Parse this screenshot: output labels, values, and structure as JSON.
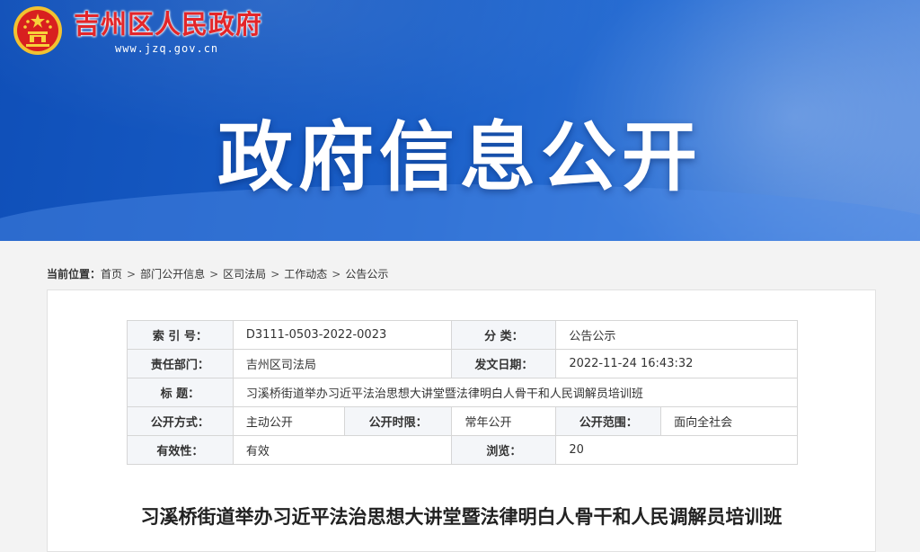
{
  "header": {
    "site_name": "吉州区人民政府",
    "site_url": "www.jzq.gov.cn",
    "banner_title": "政府信息公开"
  },
  "breadcrumb": {
    "label": "当前位置：",
    "items": [
      "首页",
      "部门公开信息",
      "区司法局",
      "工作动态",
      "公告公示"
    ]
  },
  "meta": {
    "index_no_label": "索 引 号：",
    "index_no": "D3111-0503-2022-0023",
    "category_label": "分 类：",
    "category": "公告公示",
    "dept_label": "责任部门：",
    "dept": "吉州区司法局",
    "date_label": "发文日期：",
    "date": "2022-11-24 16:43:32",
    "title_label": "标 题：",
    "title": "习溪桥街道举办习近平法治思想大讲堂暨法律明白人骨干和人民调解员培训班",
    "mode_label": "公开方式：",
    "mode": "主动公开",
    "period_label": "公开时限：",
    "period": "常年公开",
    "scope_label": "公开范围：",
    "scope": "面向全社会",
    "validity_label": "有效性：",
    "validity": "有效",
    "views_label": "浏览：",
    "views": "20"
  },
  "article": {
    "title": "习溪桥街道举办习近平法治思想大讲堂暨法律明白人骨干和人民调解员培训班"
  },
  "colors": {
    "brand_red": "#e3262a",
    "banner_blue": "#1a5fc8"
  }
}
